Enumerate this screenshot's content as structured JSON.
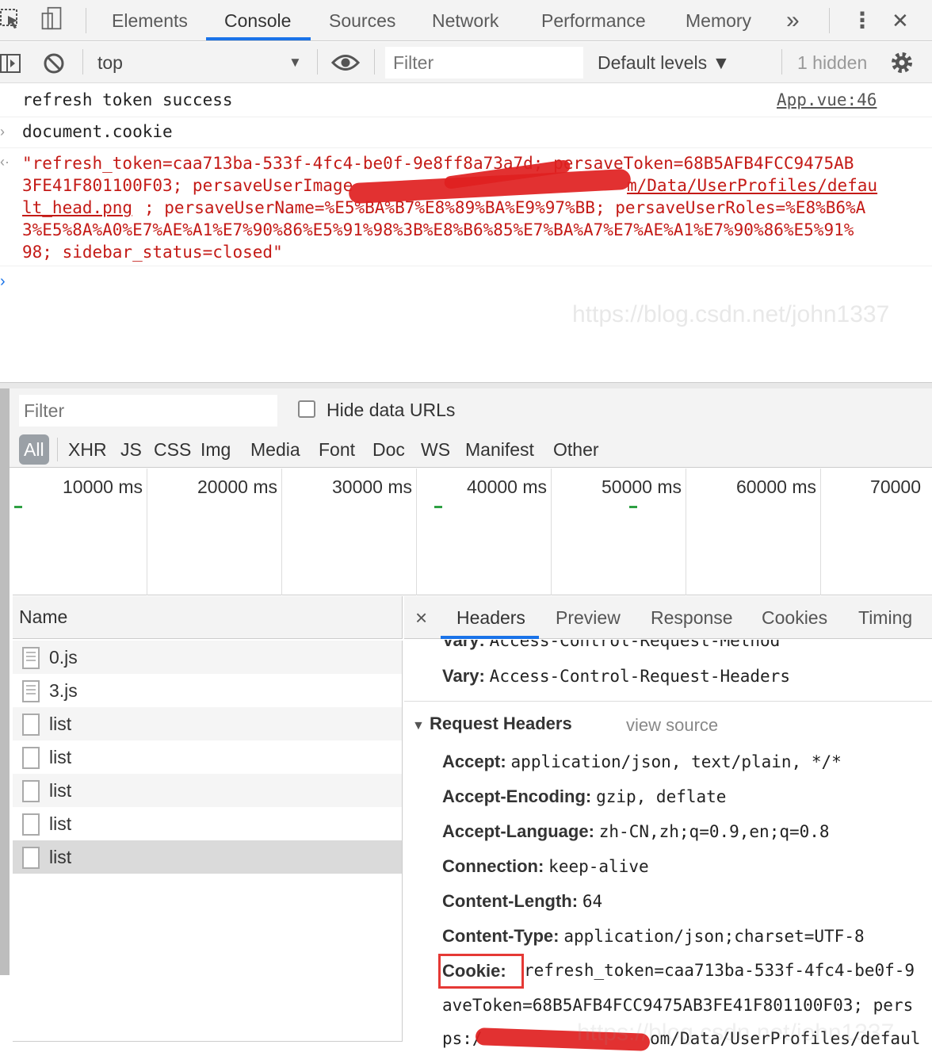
{
  "toolbar": {
    "tabs": [
      "Elements",
      "Console",
      "Sources",
      "Network",
      "Performance",
      "Memory"
    ],
    "more": "»",
    "menu": "⋮",
    "close": "✕"
  },
  "console_bar": {
    "context": "top",
    "context_arrow": "▼",
    "filter_placeholder": "Filter",
    "levels": "Default levels ▼",
    "hidden": "1 hidden"
  },
  "console": {
    "log1_text": "refresh token success",
    "log1_source": "App.vue:46",
    "input": "document.cookie",
    "output_lines": [
      "\"refresh_token=caa713ba-533f-4fc4-be0f-9e8ff8a73a7d; persaveToken=68B5AFB4FCC9475AB",
      "3FE41F801100F03; persaveUserImage",
      "m/Data/UserProfiles/defau",
      "lt_head.png",
      "; persaveUserName=%E5%BA%B7%E8%89%BA%E9%97%BB; persaveUserRoles=%E8%B6%A",
      "3%E5%8A%A0%E7%AE%A1%E7%90%86%E5%91%98%3B%E8%B6%85%E7%BA%A7%E7%AE%A1%E7%90%86%E5%91%",
      "98; sidebar_status=closed\""
    ],
    "watermark": "https://blog.csdn.net/john1337"
  },
  "network": {
    "filter_placeholder": "Filter",
    "hide_data_urls": "Hide data URLs",
    "types": [
      "All",
      "XHR",
      "JS",
      "CSS",
      "Img",
      "Media",
      "Font",
      "Doc",
      "WS",
      "Manifest",
      "Other"
    ],
    "timeline_ticks": [
      "10000 ms",
      "20000 ms",
      "30000 ms",
      "40000 ms",
      "50000 ms",
      "60000 ms",
      "70000"
    ],
    "name_header": "Name",
    "requests": [
      "0.js",
      "3.js",
      "list",
      "list",
      "list",
      "list",
      "list"
    ],
    "detail_tabs": [
      "Headers",
      "Preview",
      "Response",
      "Cookies",
      "Timing"
    ],
    "detail_close": "×",
    "response_headers": [
      {
        "name": "Vary:",
        "value": "Access-Control-Request-Method"
      },
      {
        "name": "Vary:",
        "value": "Access-Control-Request-Headers"
      }
    ],
    "request_headers_title": "Request Headers",
    "view_source": "view source",
    "request_headers": [
      {
        "name": "Accept:",
        "value": "application/json, text/plain, */*"
      },
      {
        "name": "Accept-Encoding:",
        "value": "gzip, deflate"
      },
      {
        "name": "Accept-Language:",
        "value": "zh-CN,zh;q=0.9,en;q=0.8"
      },
      {
        "name": "Connection:",
        "value": "keep-alive"
      },
      {
        "name": "Content-Length:",
        "value": "64"
      },
      {
        "name": "Content-Type:",
        "value": "application/json;charset=UTF-8"
      },
      {
        "name": "Cookie:",
        "value": "refresh_token=caa713ba-533f-4fc4-be0f-9"
      }
    ],
    "cookie_cont1": "aveToken=68B5AFB4FCC9475AB3FE41F801100F03; pers",
    "cookie_cont2_pre": "ps:/",
    "cookie_cont2_post": "om/Data/UserProfiles/defaul"
  },
  "colors": {
    "accent": "#1a73e8",
    "string_red": "#c41a16",
    "highlight_box": "#e53935"
  }
}
